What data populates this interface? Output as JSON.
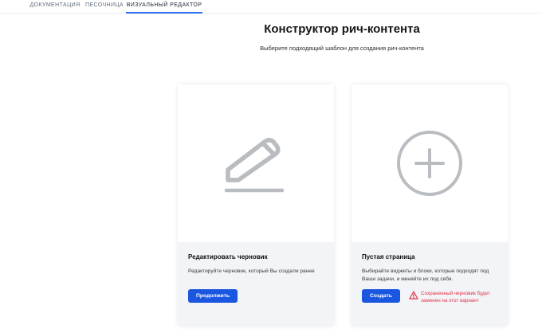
{
  "tabs": [
    {
      "label": "Документация",
      "active": false
    },
    {
      "label": "Песочница",
      "active": false
    },
    {
      "label": "Визуальный редактор",
      "active": true
    }
  ],
  "header": {
    "title": "Конструктор рич-контента",
    "subtitle": "Выберите подходящий шаблон для создания рич-контента"
  },
  "cards": [
    {
      "icon": "pencil-icon",
      "title": "Редактировать черновик",
      "description": "Редактируйте черновик, который Вы создали ранее",
      "button_label": "Продолжить"
    },
    {
      "icon": "plus-circle-icon",
      "title": "Пустая страница",
      "description": "Выбирайте виджеты и блоки, которые подходят под Ваши задачи, и меняйте их под себя.",
      "button_label": "Создать",
      "warning": "Сохраненный черновик будет заменен на этот вариант"
    }
  ],
  "colors": {
    "accent": "#1a56e0",
    "warning": "#e0344a",
    "icon_gray": "#b9bcc0",
    "card_footer_bg": "#f2f4f7"
  }
}
